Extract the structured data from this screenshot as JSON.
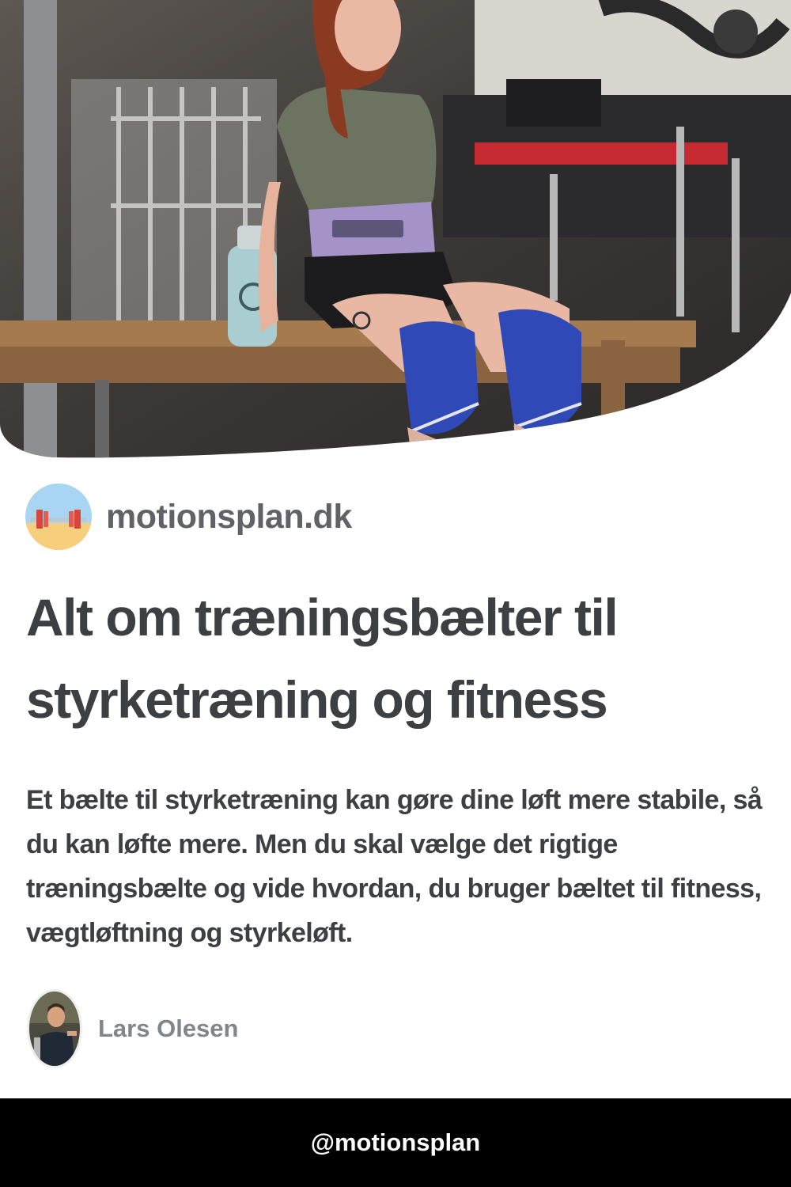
{
  "site": {
    "name": "motionsplan.dk",
    "logo_icon": "barbell-logo-icon"
  },
  "article": {
    "title": "Alt om træningsbælter til styrketræning og fitness",
    "description": "Et bælte til styrketræning kan gøre dine løft mere stabile, så du kan løfte mere. Men du skal vælge det rigtige træningsbælte og vide hvordan, du bruger bæltet til fitness, vægtløftning og styrkeløft."
  },
  "author": {
    "name": "Lars Olesen",
    "avatar_icon": "author-avatar-photo"
  },
  "footer": {
    "handle": "@motionsplan"
  },
  "colors": {
    "title": "#3c4043",
    "site_name": "#5f6368",
    "author_name": "#80868b",
    "footer_bg": "#000000",
    "footer_text": "#ffffff"
  }
}
